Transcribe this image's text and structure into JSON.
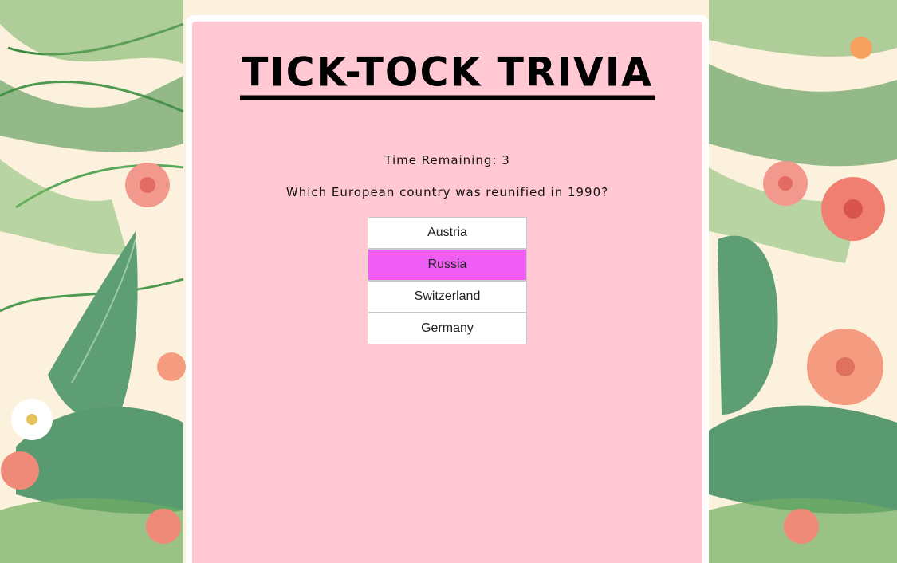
{
  "app": {
    "title": "TICK-TOCK TRIVIA"
  },
  "timer": {
    "text": "Time Remaining: 3"
  },
  "question": {
    "text": "Which European country was reunified in 1990?"
  },
  "answers": [
    {
      "label": "Austria",
      "selected": false
    },
    {
      "label": "Russia",
      "selected": true
    },
    {
      "label": "Switzerland",
      "selected": false
    },
    {
      "label": "Germany",
      "selected": false
    }
  ],
  "colors": {
    "card_background": "#ffc8d2",
    "selected_answer": "#f05df5",
    "page_background": "#fbf1dc"
  }
}
